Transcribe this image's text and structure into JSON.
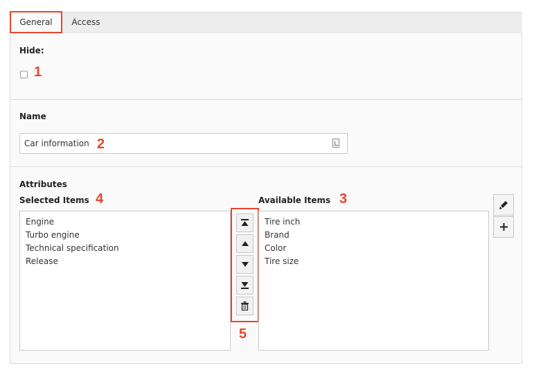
{
  "tabs": [
    {
      "label": "General"
    },
    {
      "label": "Access"
    }
  ],
  "hide": {
    "label": "Hide:",
    "checked": false,
    "marker": "1"
  },
  "name": {
    "label": "Name",
    "value": "Car information",
    "marker": "2"
  },
  "attributes": {
    "label": "Attributes",
    "selected": {
      "label": "Selected Items",
      "marker": "4",
      "items": [
        "Engine",
        "Turbo engine",
        "Technical specification",
        "Release"
      ]
    },
    "available": {
      "label": "Available Items",
      "marker": "3",
      "items": [
        "Tire inch",
        "Brand",
        "Color",
        "Tire size"
      ]
    },
    "controls": {
      "marker": "5",
      "buttons": [
        "move-to-top-icon",
        "move-up-icon",
        "move-down-icon",
        "move-to-bottom-icon",
        "trash-icon"
      ]
    },
    "side_buttons": [
      "pencil-icon",
      "plus-icon"
    ]
  },
  "colors": {
    "highlight": "#e8452c",
    "panel": "#fafafa",
    "tabbar": "#ededed"
  }
}
